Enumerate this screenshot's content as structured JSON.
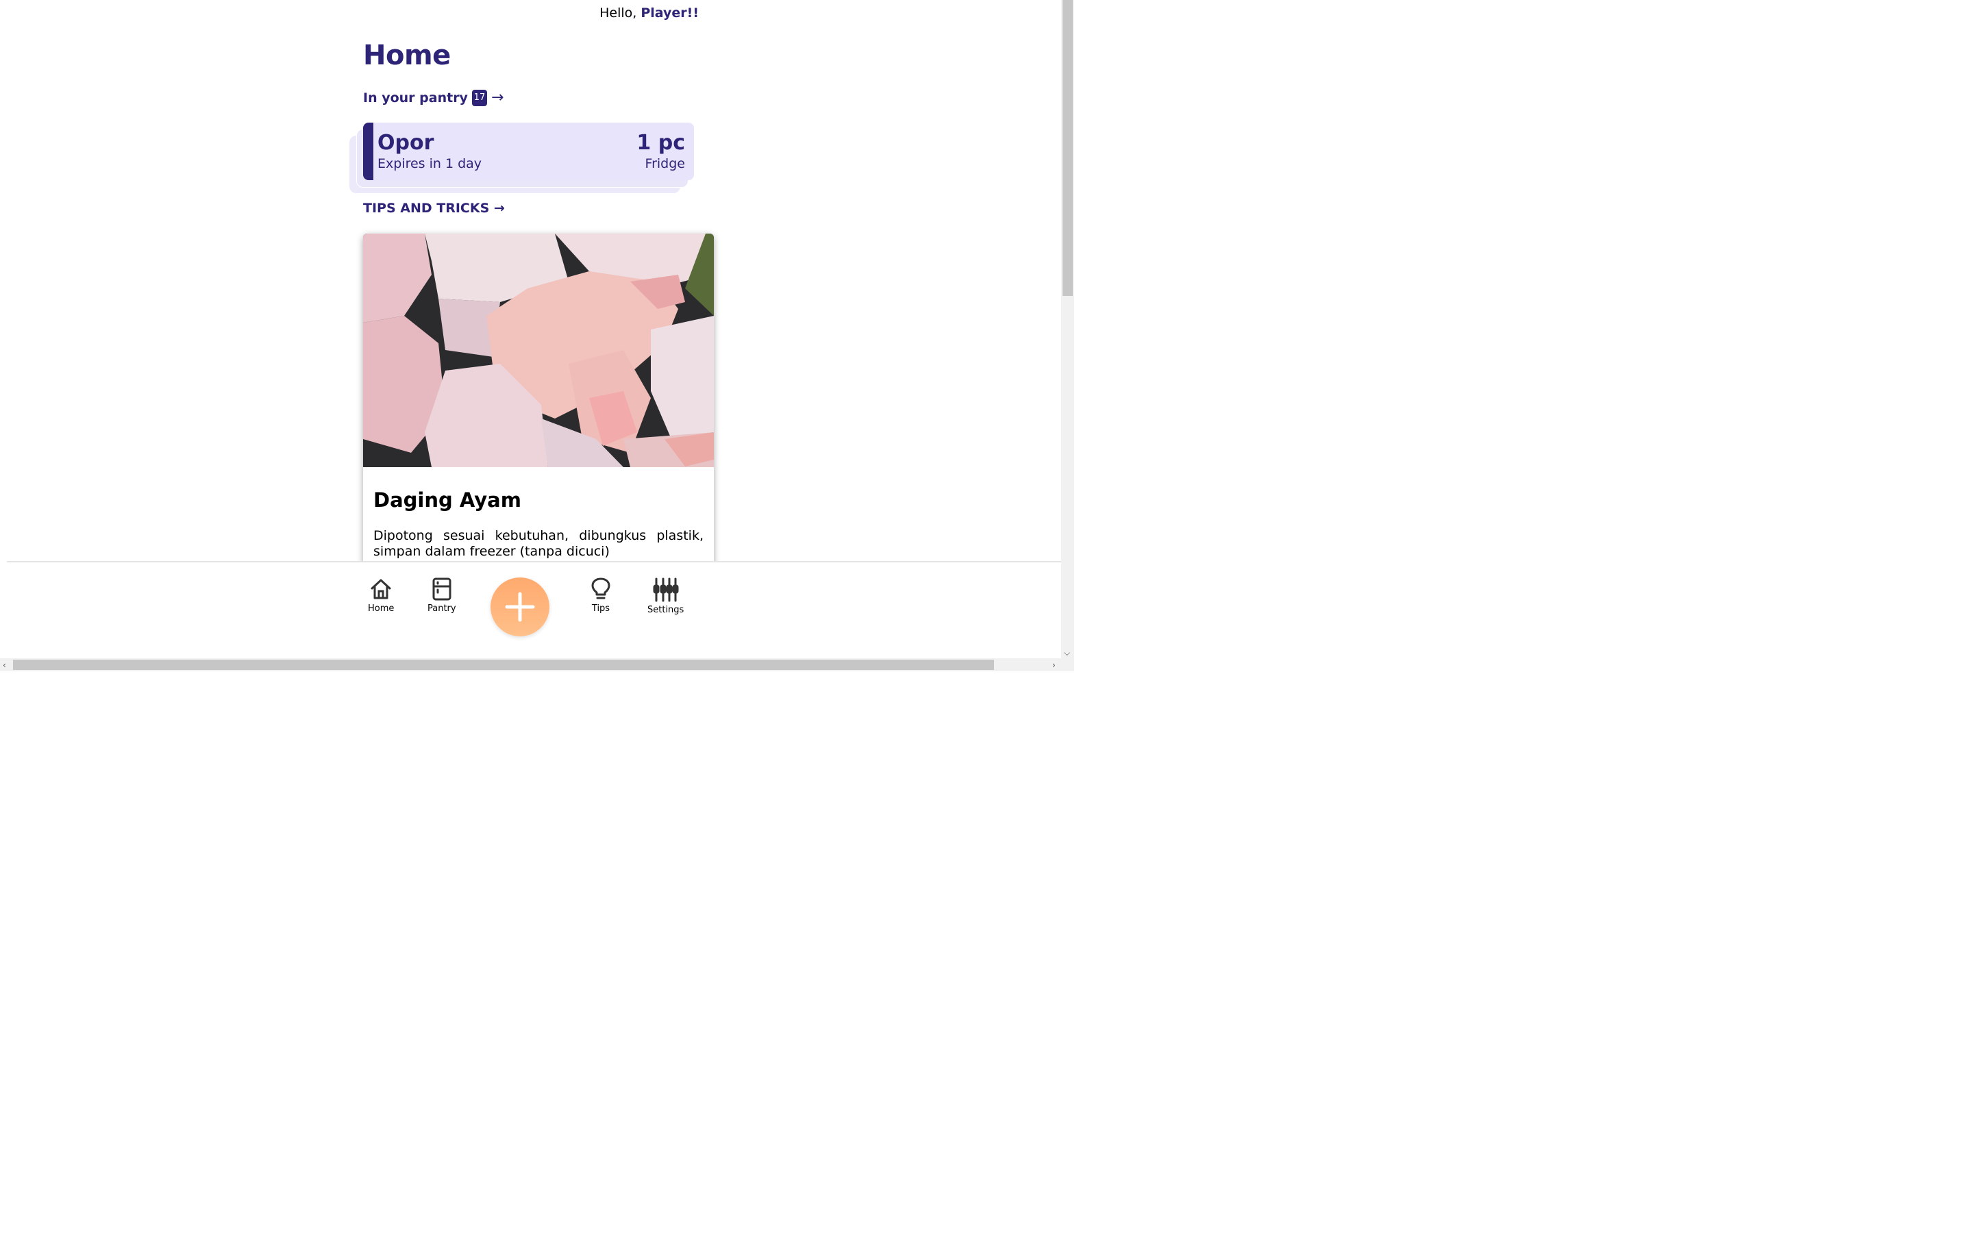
{
  "header": {
    "greeting": "Hello,",
    "username": "Player!!"
  },
  "page": {
    "title": "Home"
  },
  "pantry": {
    "label": "In your pantry",
    "count": "17",
    "arrow": "→",
    "highlight": {
      "name": "Opor",
      "expiry": "Expires in 1 day",
      "quantity": "1 pc",
      "location": "Fridge"
    }
  },
  "tips": {
    "section_label": "TIPS AND TRICKS →",
    "card": {
      "title": "Daging Ayam",
      "description": "Dipotong sesuai kebutuhan, dibungkus plastik, simpan dalam freezer (tanpa dicuci)",
      "image": "raw-chicken-pieces"
    }
  },
  "nav": {
    "items": [
      {
        "label": "Home",
        "icon": "home-icon"
      },
      {
        "label": "Pantry",
        "icon": "fridge-icon"
      },
      {
        "label": "Tips",
        "icon": "lightbulb-icon"
      },
      {
        "label": "Settings",
        "icon": "sliders-icon"
      }
    ],
    "fab_icon": "plus-icon"
  },
  "colors": {
    "primary": "#2d2478",
    "card_bg": "#e7e4fb",
    "fab": "#ffb47a"
  }
}
